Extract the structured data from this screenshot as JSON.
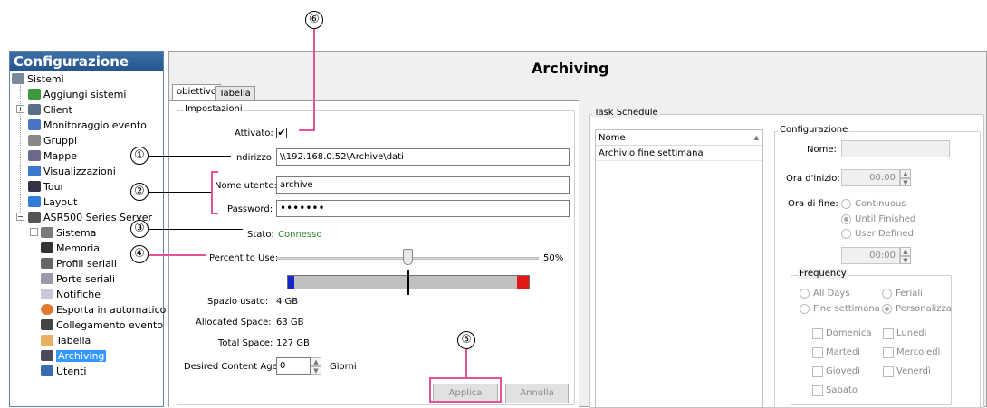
{
  "tree": {
    "title": "Configurazione",
    "nodes": [
      "Sistemi",
      "Aggiungi sistemi",
      "Client",
      "Monitoraggio evento",
      "Gruppi",
      "Mappe",
      "Visualizzazioni",
      "Tour",
      "Layout",
      "ASR500 Series Server",
      "Sistema",
      "Memoria",
      "Profili seriali",
      "Porte seriali",
      "Notifiche",
      "Esporta in automatico",
      "Collegamento evento",
      "Tabella",
      "Archiving",
      "Utenti"
    ],
    "selected": "Archiving"
  },
  "main": {
    "title": "Archiving",
    "tabs": [
      "obiettivo",
      "Tabella"
    ],
    "impostazioni": {
      "group_title": "Impostazioni",
      "attivato_label": "Attivato:",
      "attivato_checked": true,
      "check_mark": "✔",
      "indirizzo_label": "Indirizzo:",
      "indirizzo_value": "\\\\192.168.0.52\\Archive\\dati",
      "nome_utente_label": "Nome utente:",
      "nome_utente_value": "archive",
      "password_label": "Password:",
      "password_value": "•••••••",
      "stato_label": "Stato:",
      "stato_value": "Connesso",
      "percent_label": "Percent to Use:",
      "percent_value": "50%",
      "percent_fraction": 0.5,
      "spazio_usato_label": "Spazio usato:",
      "spazio_usato_value": "4 GB",
      "allocated_label": "Allocated Space:",
      "allocated_value": "63 GB",
      "total_label": "Total Space:",
      "total_value": "127 GB",
      "content_age_label": "Desired Content Age:",
      "content_age_value": "0",
      "content_age_unit": "Giorni",
      "applica_label": "Applica",
      "annulla_label": "Annulla"
    },
    "task_schedule": {
      "group_title": "Task Schedule",
      "column_header": "Nome",
      "rows": [
        "Archivio fine settimana"
      ]
    },
    "configurazione": {
      "group_title": "Configurazione",
      "nome_label": "Nome:",
      "ora_inizio_label": "Ora d'inizio:",
      "ora_inizio_value": "00:00",
      "ora_fine_label": "Ora di fine:",
      "ora_fine_options": [
        "Continuous",
        "Until Finished",
        "User Defined"
      ],
      "ora_fine_selected": "Until Finished",
      "ora_fine_value": "00:00",
      "frequency_title": "Frequency",
      "frequency_options": [
        "All Days",
        "Feriali",
        "Fine settimana",
        "Personalizza"
      ],
      "frequency_selected": "Personalizza",
      "days": [
        "Domenica",
        "Lunedì",
        "Martedì",
        "Mercoledì",
        "Giovedì",
        "Venerdì",
        "Sabato"
      ]
    }
  },
  "callouts": [
    "①",
    "②",
    "③",
    "④",
    "⑤",
    "⑥"
  ],
  "colors": {
    "tree_header": "#26548c",
    "selected": "#3399ff",
    "callout_line": "#e2539a",
    "connected_text": "#2a8a2a",
    "bar_left": "#1428c8",
    "bar_right": "#e01818"
  }
}
